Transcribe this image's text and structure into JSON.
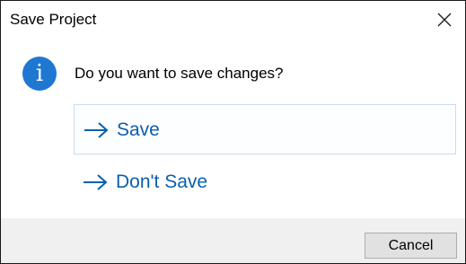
{
  "window": {
    "title": "Save Project",
    "close_icon": "close-icon"
  },
  "message": {
    "icon": "info-icon",
    "text": "Do you want to save changes?"
  },
  "commands": [
    {
      "label": "Save",
      "icon": "arrow-right-icon",
      "focused": true
    },
    {
      "label": "Don't Save",
      "icon": "arrow-right-icon",
      "focused": false
    }
  ],
  "footer": {
    "cancel_label": "Cancel"
  },
  "colors": {
    "link": "#0a5fad",
    "info_icon": "#1e78d2",
    "footer_bg": "#f0f0f0"
  }
}
